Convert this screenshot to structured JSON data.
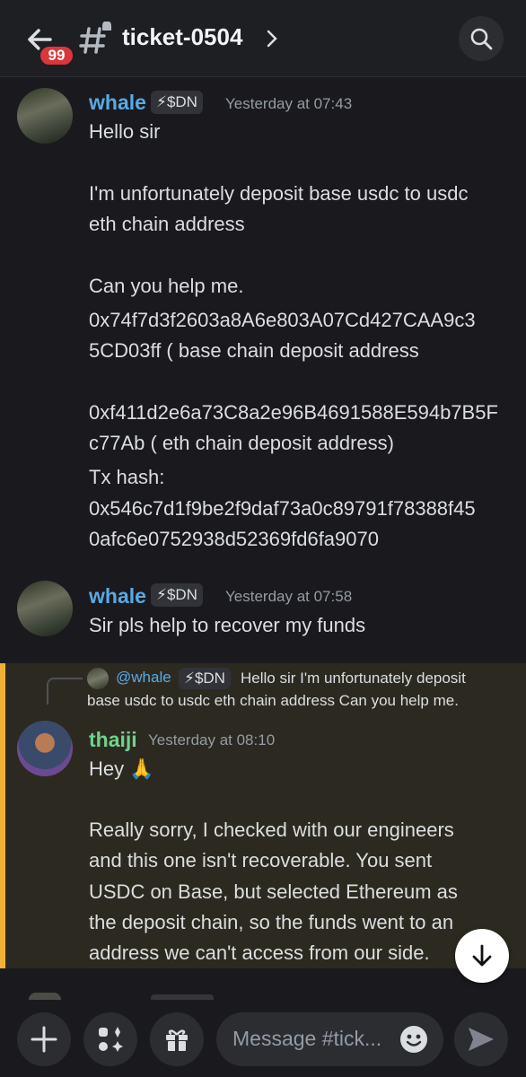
{
  "header": {
    "unread_count": "99",
    "channel_name": "ticket-0504"
  },
  "messages": [
    {
      "author": "whale",
      "tag": "$DN",
      "timestamp": "Yesterday at 07:43",
      "lines": [
        "Hello sir",
        "I'm unfortunately deposit base usdc to usdc",
        "eth chain address",
        "Can you help me.",
        "0x74f7d3f2603a8A6e803A07Cd427CAA9c3",
        "5CD03ff ( base chain deposit address",
        "0xf411d2e6a73C8a2e96B4691588E594b7B5F",
        "c77Ab ( eth chain deposit address)",
        "Tx hash:",
        "0x546c7d1f9be2f9daf73a0c89791f78388f45",
        "0afc6e0752938d52369fd6fa9070"
      ]
    },
    {
      "author": "whale",
      "tag": "$DN",
      "timestamp": "Yesterday at 07:58",
      "lines": [
        "Sir pls help to recover my funds"
      ]
    },
    {
      "reply": {
        "mention": "@whale",
        "tag": "$DN",
        "text_line1": "Hello sir  I'm unfortunately deposit",
        "text_line2": "base usdc to usdc eth chain address   Can you help me."
      },
      "author": "thaiji",
      "timestamp": "Yesterday at 08:10",
      "lines": [
        "Hey 🙏",
        "Really sorry, I checked with our engineers",
        "and this one isn't recoverable. You sent",
        "USDC on Base, but selected Ethereum as",
        "the deposit chain, so the funds went to an",
        "address we can't access from our side."
      ]
    }
  ],
  "composer": {
    "placeholder": "Message #tick..."
  },
  "icons": {
    "back": "back-arrow-icon",
    "channel": "thread-hash-icon",
    "search": "search-icon",
    "scroll": "arrow-down-icon",
    "add": "plus-icon",
    "apps": "apps-icon",
    "gift": "gift-icon",
    "emoji": "emoji-icon",
    "send": "send-icon"
  },
  "colors": {
    "accent_mention": "#f0b232",
    "whale_name": "#5aa9e6",
    "thaiji_name": "#6fd38e",
    "badge": "#da373c"
  }
}
